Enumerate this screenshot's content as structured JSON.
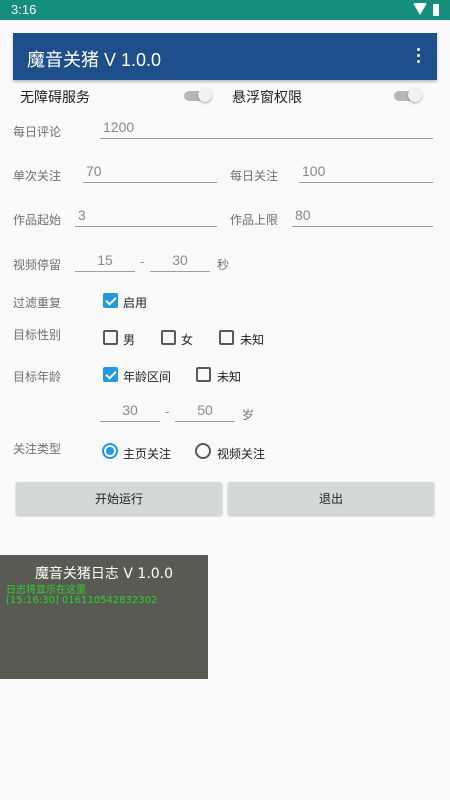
{
  "status_bar": {
    "time": "3:16",
    "wifi_icon": "wifi-icon",
    "battery_icon": "battery-icon"
  },
  "app_bar": {
    "title": "魔音关猪 V 1.0.0",
    "menu_icon": "more-vert-icon",
    "color": "#1f4e8c"
  },
  "toggles": {
    "accessibility": {
      "label": "无障碍服务",
      "on": false
    },
    "overlay": {
      "label": "悬浮窗权限",
      "on": false
    }
  },
  "form": {
    "daily_comment": {
      "label": "每日评论",
      "value": "1200"
    },
    "single_follow": {
      "label": "单次关注",
      "value": "70"
    },
    "daily_follow": {
      "label": "每日关注",
      "value": "100"
    },
    "work_start": {
      "label": "作品起始",
      "value": "3"
    },
    "work_limit": {
      "label": "作品上限",
      "value": "80"
    },
    "video_stay": {
      "label": "视频停留",
      "min": "15",
      "separator": "-",
      "max": "30",
      "unit": "秒"
    },
    "filter_dup": {
      "label": "过滤重复",
      "option": "启用",
      "checked": true
    },
    "target_gender": {
      "label": "目标性别",
      "options": [
        {
          "label": "男",
          "checked": false
        },
        {
          "label": "女",
          "checked": false
        },
        {
          "label": "未知",
          "checked": false
        }
      ]
    },
    "target_age": {
      "label": "目标年龄",
      "options": [
        {
          "label": "年龄区间",
          "checked": true
        },
        {
          "label": "未知",
          "checked": false
        }
      ],
      "min": "30",
      "separator": "-",
      "max": "50",
      "unit": "岁"
    },
    "follow_type": {
      "label": "关注类型",
      "options": [
        {
          "label": "主页关注",
          "selected": true
        },
        {
          "label": "视频关注",
          "selected": false
        }
      ]
    }
  },
  "buttons": {
    "start": "开始运行",
    "exit": "退出"
  },
  "log": {
    "title": "魔音关猪日志 V 1.0.0",
    "lines": [
      "日志将显示在这里",
      "[15:16:30] 016110542832302"
    ]
  },
  "colors": {
    "accent": "#1e9ae0",
    "status_bar": "#148f7e",
    "log_text": "#28d428",
    "log_bg": "#5a5a54"
  }
}
